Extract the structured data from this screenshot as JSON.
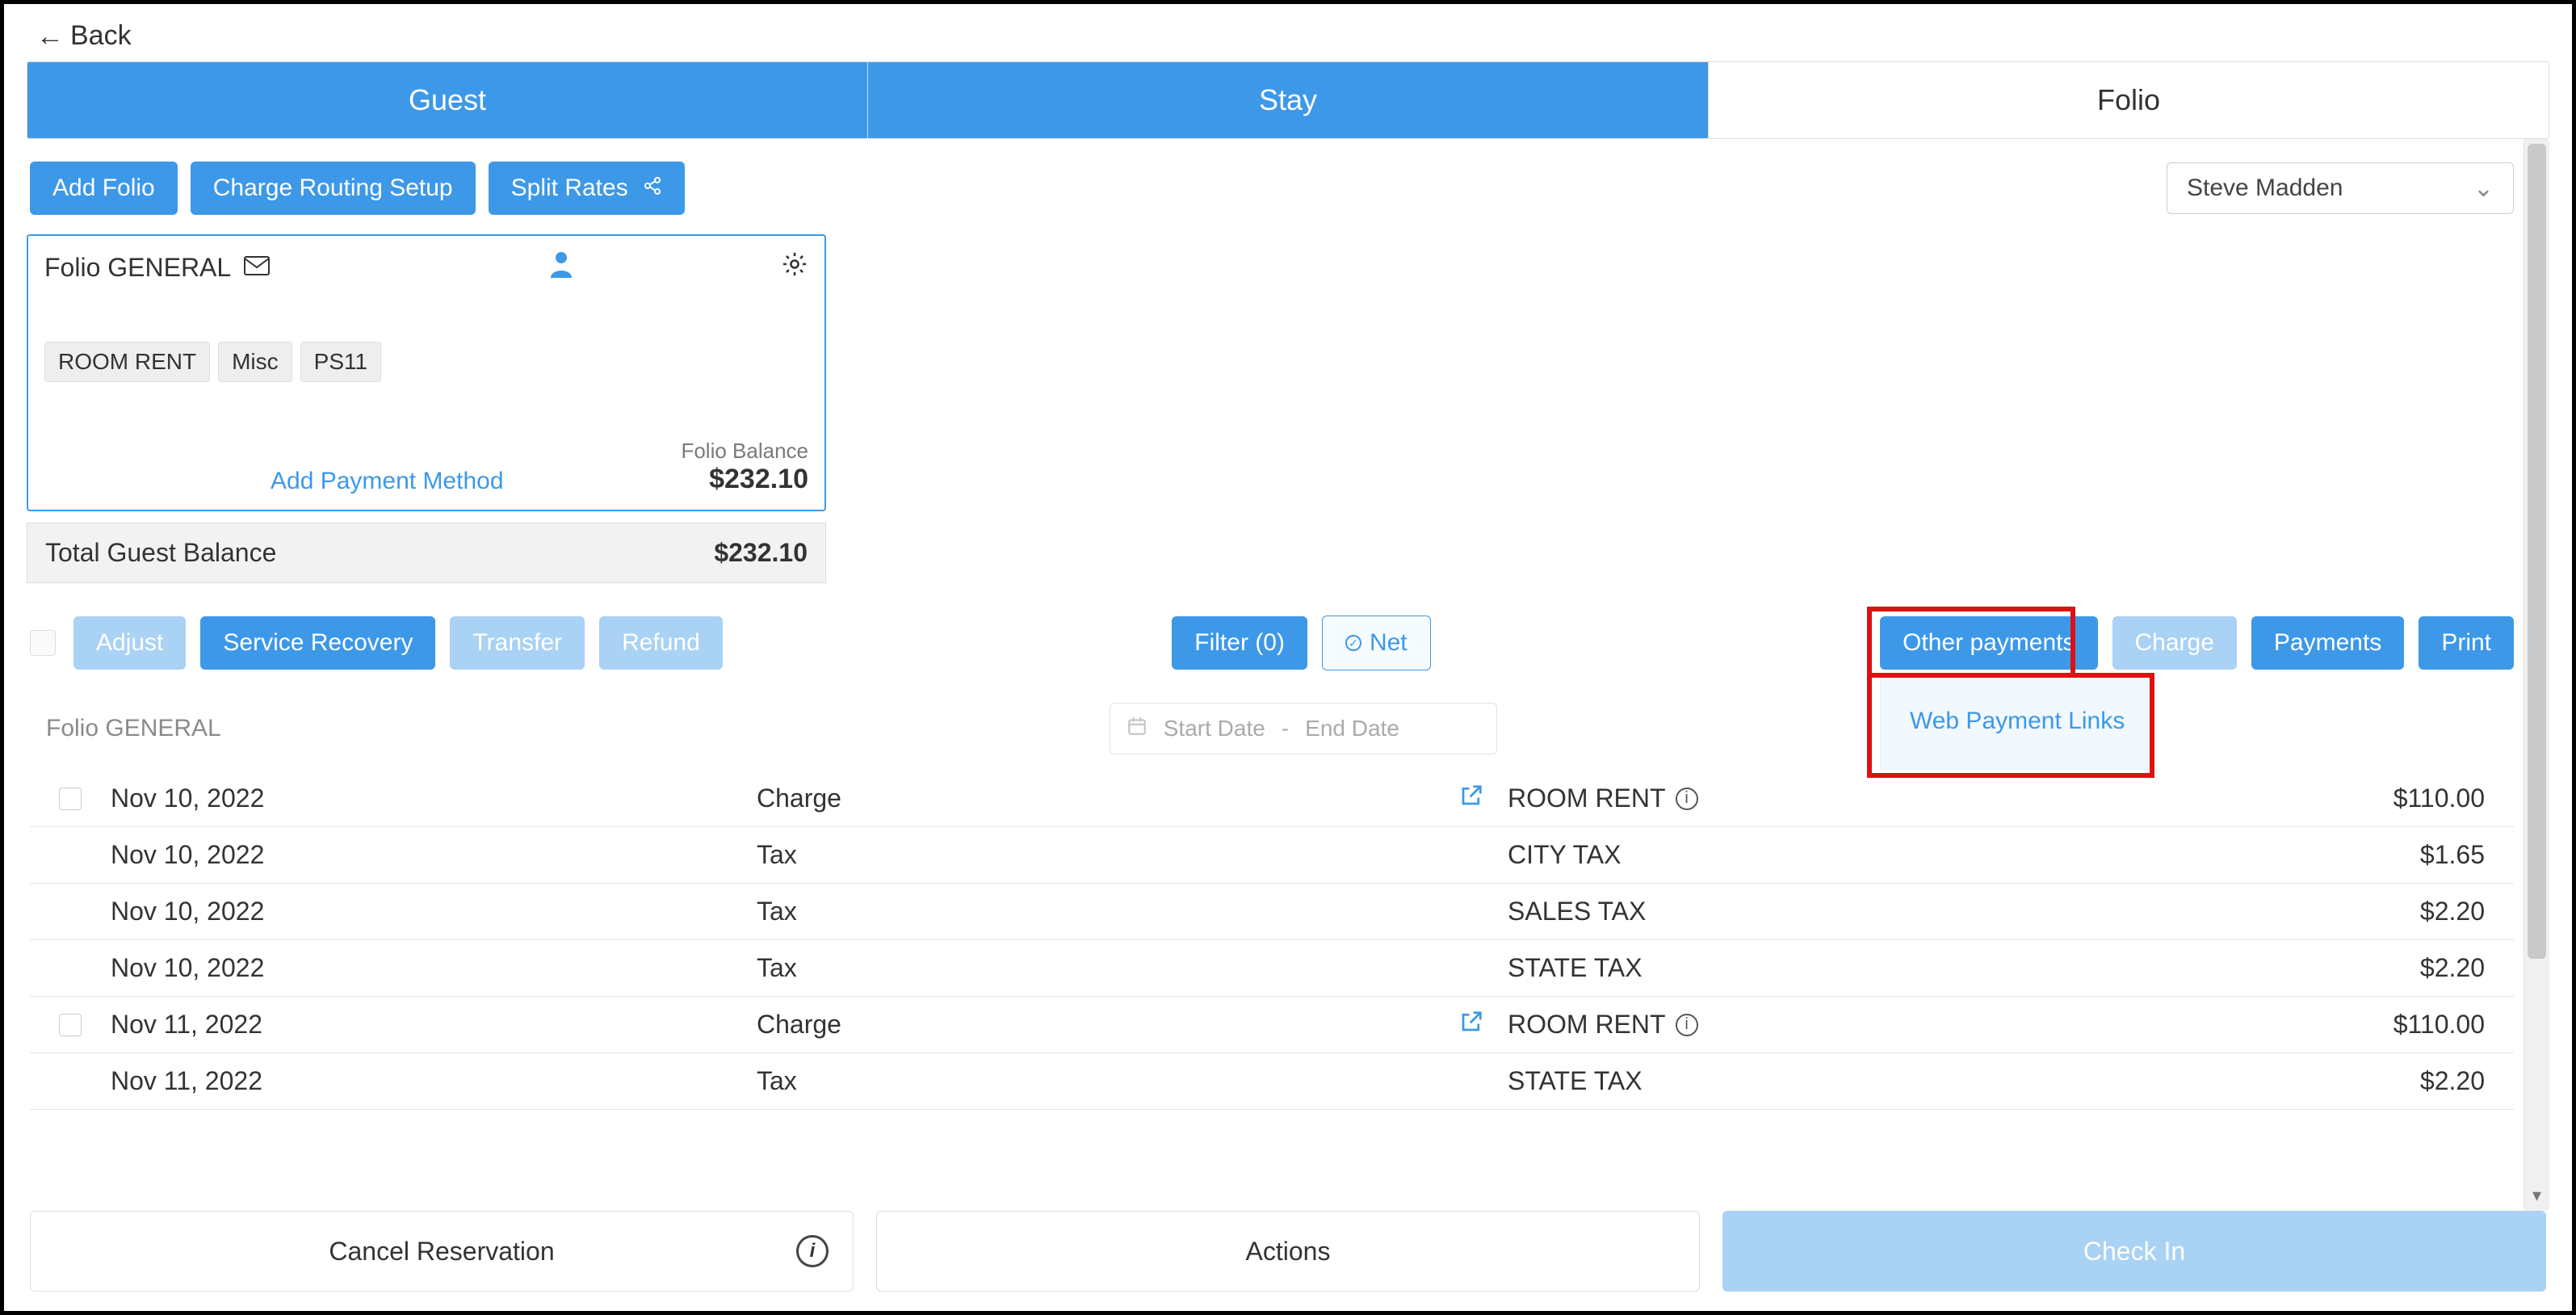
{
  "back_label": "Back",
  "tabs": {
    "guest": "Guest",
    "stay": "Stay",
    "folio": "Folio"
  },
  "toolbar": {
    "add_folio": "Add Folio",
    "charge_routing": "Charge Routing Setup",
    "split_rates": "Split Rates"
  },
  "guest_select": {
    "value": "Steve Madden"
  },
  "folio_card": {
    "title": "Folio GENERAL",
    "chips": [
      "ROOM RENT",
      "Misc",
      "PS11"
    ],
    "add_payment": "Add Payment Method",
    "balance_label": "Folio Balance",
    "balance_amount": "$232.10"
  },
  "total_balance": {
    "label": "Total Guest Balance",
    "amount": "$232.10"
  },
  "actions": {
    "adjust": "Adjust",
    "service_recovery": "Service Recovery",
    "transfer": "Transfer",
    "refund": "Refund",
    "filter": "Filter (0)",
    "net": "Net",
    "other_payments": "Other payments",
    "charge": "Charge",
    "payments": "Payments",
    "print": "Print",
    "web_payment_links": "Web Payment Links"
  },
  "listing_title": "Folio GENERAL",
  "date_placeholder": {
    "start": "Start Date",
    "sep": "-",
    "end": "End Date"
  },
  "rows": [
    {
      "checkbox": true,
      "date": "Nov 10, 2022",
      "type": "Charge",
      "edit": true,
      "desc": "ROOM RENT",
      "info": true,
      "amount": "$110.00"
    },
    {
      "checkbox": false,
      "date": "Nov 10, 2022",
      "type": "Tax",
      "edit": false,
      "desc": "CITY TAX",
      "info": false,
      "amount": "$1.65"
    },
    {
      "checkbox": false,
      "date": "Nov 10, 2022",
      "type": "Tax",
      "edit": false,
      "desc": "SALES TAX",
      "info": false,
      "amount": "$2.20"
    },
    {
      "checkbox": false,
      "date": "Nov 10, 2022",
      "type": "Tax",
      "edit": false,
      "desc": "STATE TAX",
      "info": false,
      "amount": "$2.20"
    },
    {
      "checkbox": true,
      "date": "Nov 11, 2022",
      "type": "Charge",
      "edit": true,
      "desc": "ROOM RENT",
      "info": true,
      "amount": "$110.00"
    },
    {
      "checkbox": false,
      "date": "Nov 11, 2022",
      "type": "Tax",
      "edit": false,
      "desc": "STATE TAX",
      "info": false,
      "amount": "$2.20"
    }
  ],
  "footer": {
    "cancel": "Cancel Reservation",
    "actions": "Actions",
    "checkin": "Check In"
  }
}
